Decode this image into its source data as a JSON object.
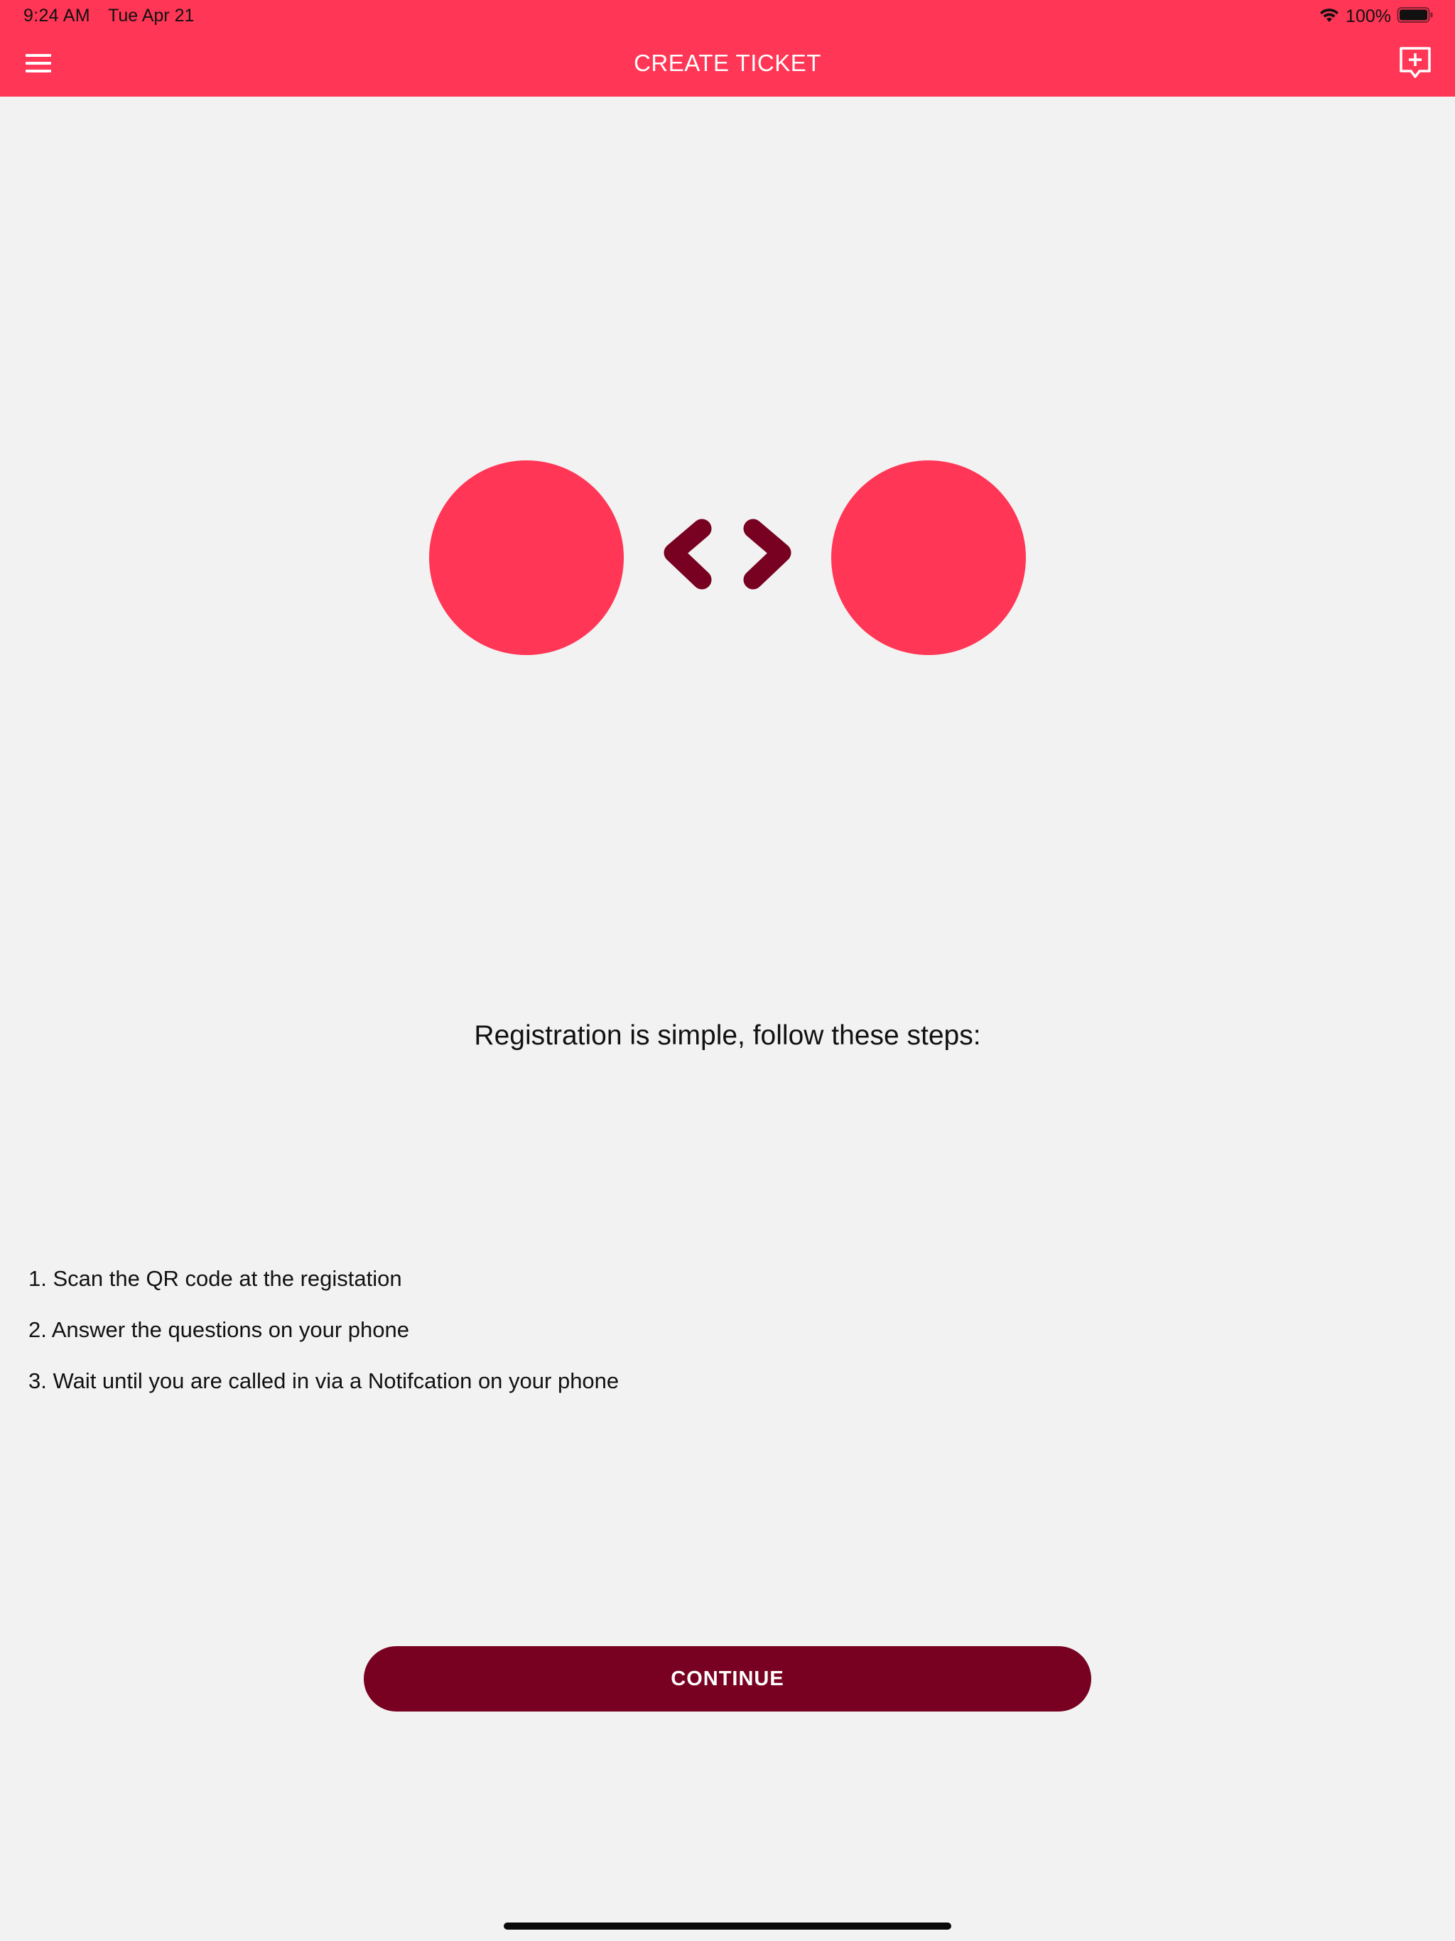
{
  "status_bar": {
    "time": "9:24 AM",
    "date": "Tue Apr 21",
    "battery": "100%"
  },
  "nav": {
    "title": "CREATE TICKET",
    "menu_icon": "hamburger-menu-icon",
    "action_icon": "add-comment-icon"
  },
  "hero": {
    "left_shape": "circle",
    "center_icon": "code-chevrons-icon",
    "right_shape": "circle"
  },
  "content": {
    "intro": "Registration is simple, follow these steps:",
    "steps": [
      "1. Scan the QR code at the registation",
      "2. Answer the questions on your phone",
      "3. Wait until you are called in via a Notifcation on your phone"
    ]
  },
  "actions": {
    "continue_label": "CONTINUE"
  },
  "colors": {
    "primary": "#ff3656",
    "accent_dark": "#780020",
    "background": "#f2f2f2"
  }
}
